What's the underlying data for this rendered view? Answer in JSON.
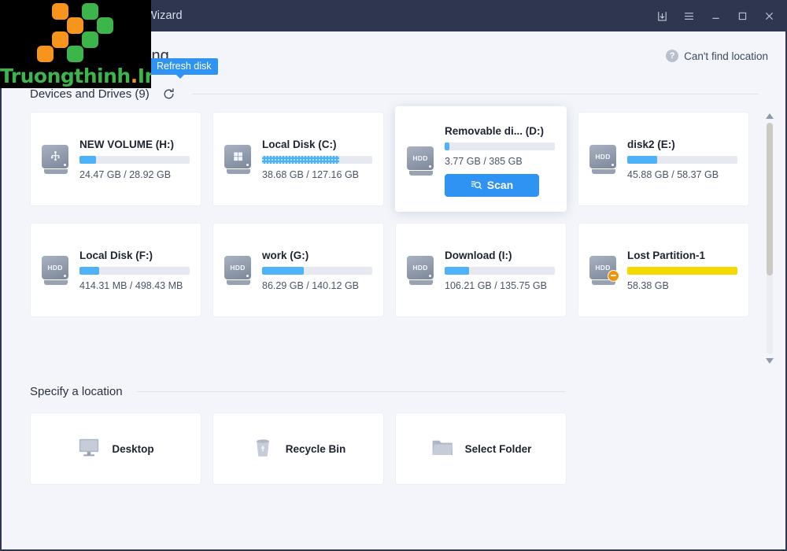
{
  "window": {
    "title": "Wizard",
    "controls": [
      {
        "name": "download-icon",
        "label": "Download"
      },
      {
        "name": "menu-icon",
        "label": "Menu"
      },
      {
        "name": "minimize-icon",
        "label": "Minimize"
      },
      {
        "name": "maximize-icon",
        "label": "Maximize"
      },
      {
        "name": "close-icon",
        "label": "Close"
      }
    ]
  },
  "header": {
    "title": "n to start recovering",
    "help_link": "Can't find location",
    "help_icon": "question-mark-icon"
  },
  "devices": {
    "section_title": "Devices and Drives (9)",
    "refresh_icon": "refresh-icon",
    "refresh_tooltip": "Refresh disk",
    "scan_button_label": "Scan",
    "items": [
      {
        "name": "NEW VOLUME  (H:)",
        "size": "24.47 GB / 28.92 GB",
        "icon": "usb-drive-icon",
        "fill_percent": 15,
        "bar_color": "#4db2f7",
        "hovered": false
      },
      {
        "name": "Local Disk (C:)",
        "size": "38.68 GB / 127.16 GB",
        "icon": "windows-disk-icon",
        "fill_percent": 70,
        "bar_color": "#4db2f7",
        "dotted": true,
        "hovered": false
      },
      {
        "name": "Removable di... (D:)",
        "size": "3.77 GB /  385 GB",
        "icon": "hdd-icon",
        "fill_percent": 4,
        "bar_color": "#4db2f7",
        "hovered": true
      },
      {
        "name": "disk2 (E:)",
        "size": "45.88 GB / 58.37 GB",
        "icon": "hdd-icon",
        "fill_percent": 27,
        "bar_color": "#4db2f7",
        "hovered": false
      },
      {
        "name": "Local Disk (F:)",
        "size": "414.31 MB / 498.43 MB",
        "icon": "hdd-icon",
        "fill_percent": 18,
        "bar_color": "#4db2f7",
        "hovered": false
      },
      {
        "name": "work (G:)",
        "size": "86.29 GB / 140.12 GB",
        "icon": "hdd-icon",
        "fill_percent": 38,
        "bar_color": "#4db2f7",
        "hovered": false
      },
      {
        "name": "Download (I:)",
        "size": "106.21 GB / 135.75 GB",
        "icon": "hdd-icon",
        "fill_percent": 22,
        "bar_color": "#4db2f7",
        "hovered": false
      },
      {
        "name": "Lost Partition-1",
        "size": "58.38 GB",
        "icon": "hdd-lost-icon",
        "fill_percent": 100,
        "bar_color": "#f5d800",
        "lost": true,
        "hovered": false
      }
    ]
  },
  "location": {
    "section_title": "Specify a location",
    "items": [
      {
        "label": "Desktop",
        "icon": "desktop-monitor-icon"
      },
      {
        "label": "Recycle Bin",
        "icon": "recycle-bin-icon"
      },
      {
        "label": "Select Folder",
        "icon": "folder-icon"
      }
    ]
  },
  "watermark": {
    "text_main": "Truongthinh",
    "text_dot": ".",
    "text_suffix": "Info",
    "colors": {
      "green": "#3cb54a",
      "orange": "#f7941e"
    }
  },
  "colors": {
    "titlebar": "#2e3650",
    "accent": "#2f93f4",
    "page_bg": "#f3f5fa",
    "bar_blue": "#4db2f7",
    "bar_yellow": "#f5d800",
    "lost_badge": "#f39200"
  }
}
